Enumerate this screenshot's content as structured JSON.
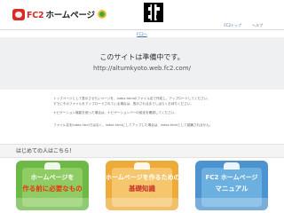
{
  "header": {
    "brand_fc2": "FC2",
    "brand_rest": "ホームページ",
    "nav": [
      {
        "label": "FC2トップ"
      },
      {
        "label": "ヘルプ"
      }
    ]
  },
  "top_link": "FC2へ",
  "notice": {
    "title": "このサイトは準備中です。",
    "url": "http://altumkyoto.web.fc2.com/"
  },
  "info": [
    "トップページとして表示させたいページを、index.htmlのファイル名で作成し、アップロードしてください。\nすでにそのファイルをアップロードされている場合は、表示されるまでしばらくお待ちください。",
    "ナビゲーション機能を使った場合は、ナビゲーションバーの設定を確認してください。",
    "ファイル名をindex.htmlではなく、index.htmlにしてアップした場合は、index.htmlとして認識されません。"
  ],
  "welcome": {
    "title": "はじめての人はこちら！"
  },
  "cards": [
    {
      "line1": "ホームページを",
      "line2": "作る前に必要なもの"
    },
    {
      "line1": "ホームページを作るための",
      "line2": "基礎知識"
    },
    {
      "line1": "FC2 ホームページ",
      "line2": "マニュアル"
    }
  ],
  "colors": {
    "brand_red": "#d62b27",
    "link_blue": "#4a70b0",
    "card_green": "#6cb947",
    "card_orange": "#eeab3a",
    "card_blue": "#4c93cf"
  }
}
